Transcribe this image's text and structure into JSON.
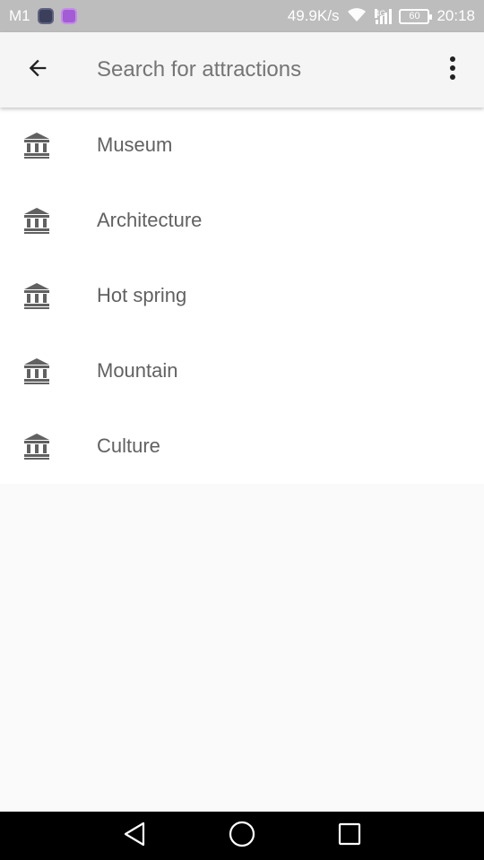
{
  "status_bar": {
    "carrier": "M1",
    "net_speed": "49.9K/s",
    "network_type": "4G",
    "battery": "60",
    "time": "20:18"
  },
  "app_bar": {
    "search_placeholder": "Search for attractions",
    "back_icon": "arrow-back-icon",
    "menu_icon": "more-vert-icon"
  },
  "categories": [
    {
      "label": "Museum",
      "icon": "museum-icon"
    },
    {
      "label": "Architecture",
      "icon": "museum-icon"
    },
    {
      "label": "Hot spring",
      "icon": "museum-icon"
    },
    {
      "label": "Mountain",
      "icon": "museum-icon"
    },
    {
      "label": "Culture",
      "icon": "museum-icon"
    }
  ],
  "colors": {
    "status_bar_bg": "#bdbdbd",
    "app_bar_bg": "#f5f5f5",
    "icon_color": "#616161",
    "text_color": "#616161",
    "nav_bar_bg": "#000000"
  }
}
